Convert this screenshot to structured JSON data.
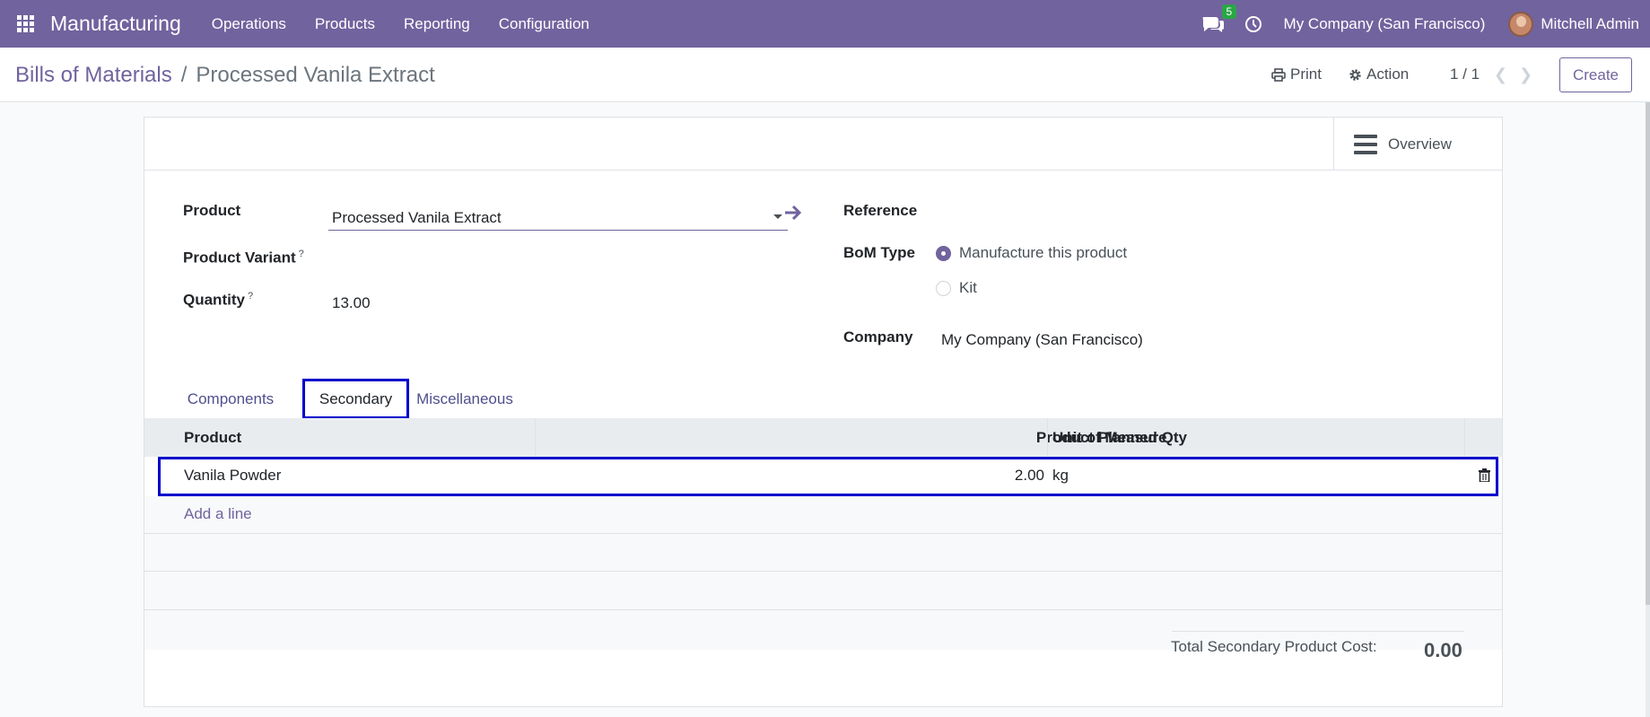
{
  "navbar": {
    "app_name": "Manufacturing",
    "menu": [
      "Operations",
      "Products",
      "Reporting",
      "Configuration"
    ],
    "messages_badge": "5",
    "company": "My Company (San Francisco)",
    "user": "Mitchell Admin"
  },
  "control_panel": {
    "breadcrumb_parent": "Bills of Materials",
    "breadcrumb_separator": "/",
    "breadcrumb_current": "Processed Vanila Extract",
    "print_label": "Print",
    "action_label": "Action",
    "pager": "1 / 1",
    "create_label": "Create"
  },
  "form": {
    "overview_label": "Overview",
    "product_label": "Product",
    "product_value": "Processed Vanila Extract",
    "variant_label": "Product Variant",
    "help_mark": "?",
    "quantity_label": "Quantity",
    "quantity_value": "13.00",
    "reference_label": "Reference",
    "bom_type_label": "BoM Type",
    "bom_type_options": [
      "Manufacture this product",
      "Kit"
    ],
    "bom_type_selected": "Manufacture this product",
    "company_label": "Company",
    "company_value": "My Company (San Francisco)"
  },
  "tabs": {
    "items": [
      "Components",
      "Secondary",
      "Miscellaneous"
    ],
    "active": "Secondary"
  },
  "table": {
    "columns": [
      "Product",
      "Product Planned Qty",
      "Unit of Measure"
    ],
    "rows": [
      {
        "product": "Vanila Powder",
        "qty": "2.00",
        "uom": "kg"
      }
    ],
    "add_line": "Add a line"
  },
  "totals": {
    "label": "Total Secondary Product Cost:",
    "value": "0.00"
  },
  "colors": {
    "brand": "#71639e",
    "highlight": "#0000cc",
    "badge": "#28a745"
  }
}
